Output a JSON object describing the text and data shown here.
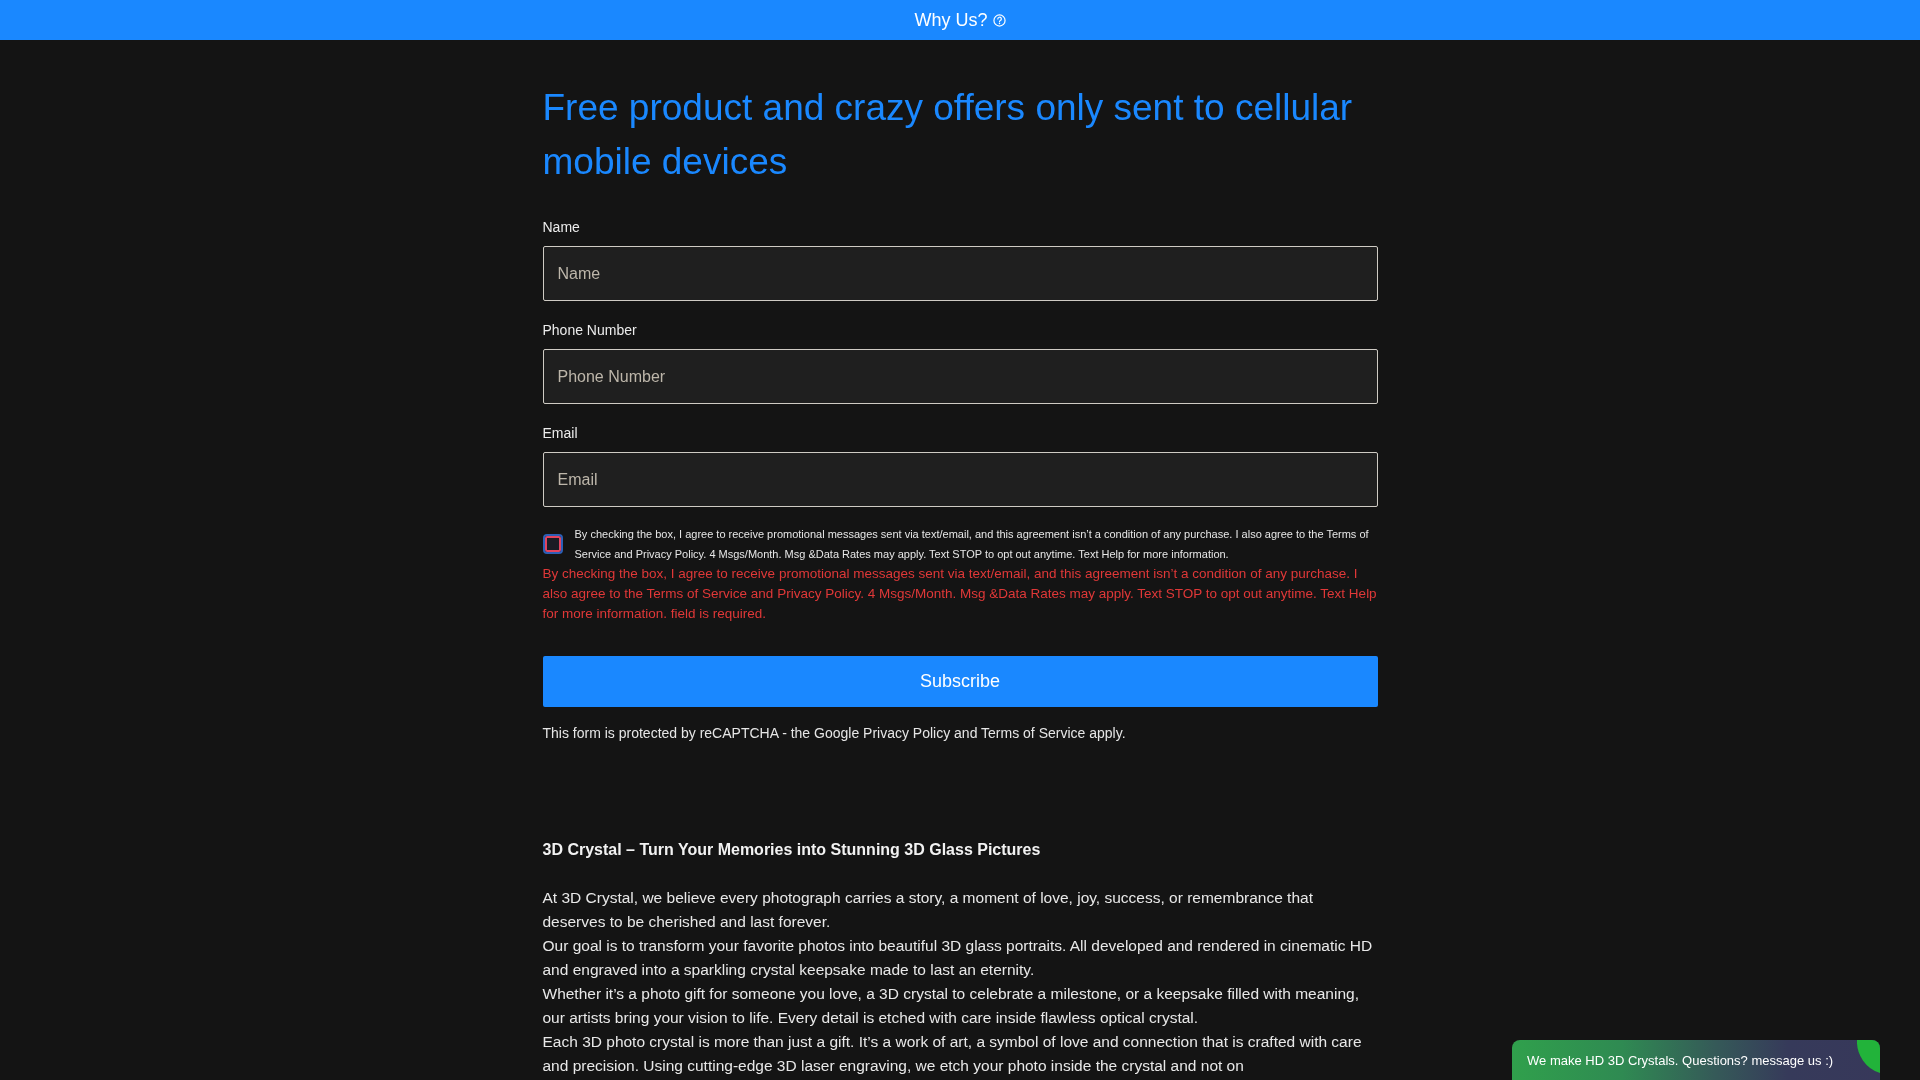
{
  "top_bar": {
    "title": "Why Us?"
  },
  "form": {
    "heading": "Free product and crazy offers only sent to cellular mobile devices",
    "fields": [
      {
        "label": "Name",
        "placeholder": "Name"
      },
      {
        "label": "Phone Number",
        "placeholder": "Phone Number"
      },
      {
        "label": "Email",
        "placeholder": "Email"
      }
    ],
    "consent": {
      "checked": false,
      "focused": true,
      "invalid": true,
      "text": "By checking the box, I agree to receive promotional messages sent via text/email, and this agreement isn’t a condition of any purchase. I also agree to the Terms of Service and Privacy Policy. 4 Msgs/Month. Msg &Data Rates may apply. Text STOP to opt out anytime. Text Help for more information.",
      "error": "By checking the box, I agree to receive promotional messages sent via text/email, and this agreement isn’t a condition of any purchase. I also agree to the Terms of Service and Privacy Policy. 4 Msgs/Month. Msg &Data Rates may apply. Text STOP to opt out anytime. Text Help for more information. field is required."
    },
    "submit": "Subscribe",
    "recaptcha_note": "This form is protected by reCAPTCHA - the Google Privacy Policy and Terms of Service apply."
  },
  "about": {
    "title": "3D Crystal – Turn Your Memories into Stunning 3D Glass Pictures",
    "paragraphs": [
      "At 3D Crystal, we believe every photograph carries a story, a moment of love, joy, success, or remembrance that deserves to be cherished and last forever.",
      "Our goal is to transform your favorite photos into beautiful 3D glass portraits. All developed and rendered in cinematic HD and engraved into a sparkling crystal keepsake made to last an eternity.",
      "Whether it’s a photo gift for someone you love, a 3D crystal to celebrate a milestone, or a keepsake filled with meaning, our artists bring your vision to life. Every detail is etched with care inside flawless optical crystal.",
      "Each 3D photo crystal is more than just a gift. It’s a work of art, a symbol of love and connection that is crafted with care and precision. Using cutting-edge 3D laser engraving, we etch your photo inside the crystal and not on"
    ]
  },
  "chat_widget": {
    "message": "We make HD 3D Crystals. Questions? message us :)"
  }
}
